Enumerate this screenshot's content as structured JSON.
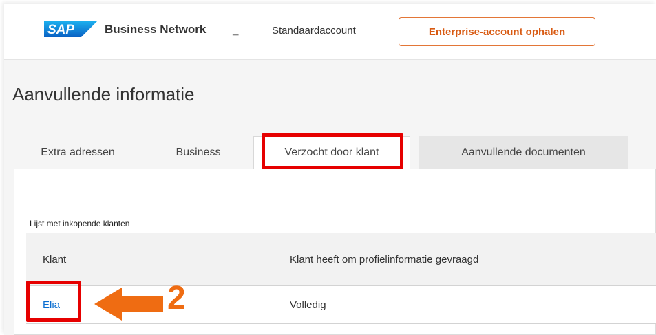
{
  "header": {
    "logo_text": "SAP",
    "brand": "Business Network",
    "account_label": "Standaardaccount",
    "enterprise_button": "Enterprise-account ophalen"
  },
  "page": {
    "title": "Aanvullende informatie"
  },
  "tabs": [
    {
      "label": "Extra adressen"
    },
    {
      "label": "Business"
    },
    {
      "label": "Verzocht door klant",
      "selected": true
    },
    {
      "label": "Aanvullende documenten"
    }
  ],
  "list": {
    "title": "Lijst met inkopende klanten",
    "columns": [
      "Klant",
      "Klant heeft om profielinformatie gevraagd"
    ],
    "rows": [
      {
        "customer": "Elia",
        "status": "Volledig"
      }
    ]
  },
  "annotation": {
    "step_number": "2",
    "highlight_color": "#e60000",
    "arrow_color": "#ef6c12"
  },
  "colors": {
    "accent_orange": "#d85a12",
    "link_blue": "#0a6ed1"
  }
}
